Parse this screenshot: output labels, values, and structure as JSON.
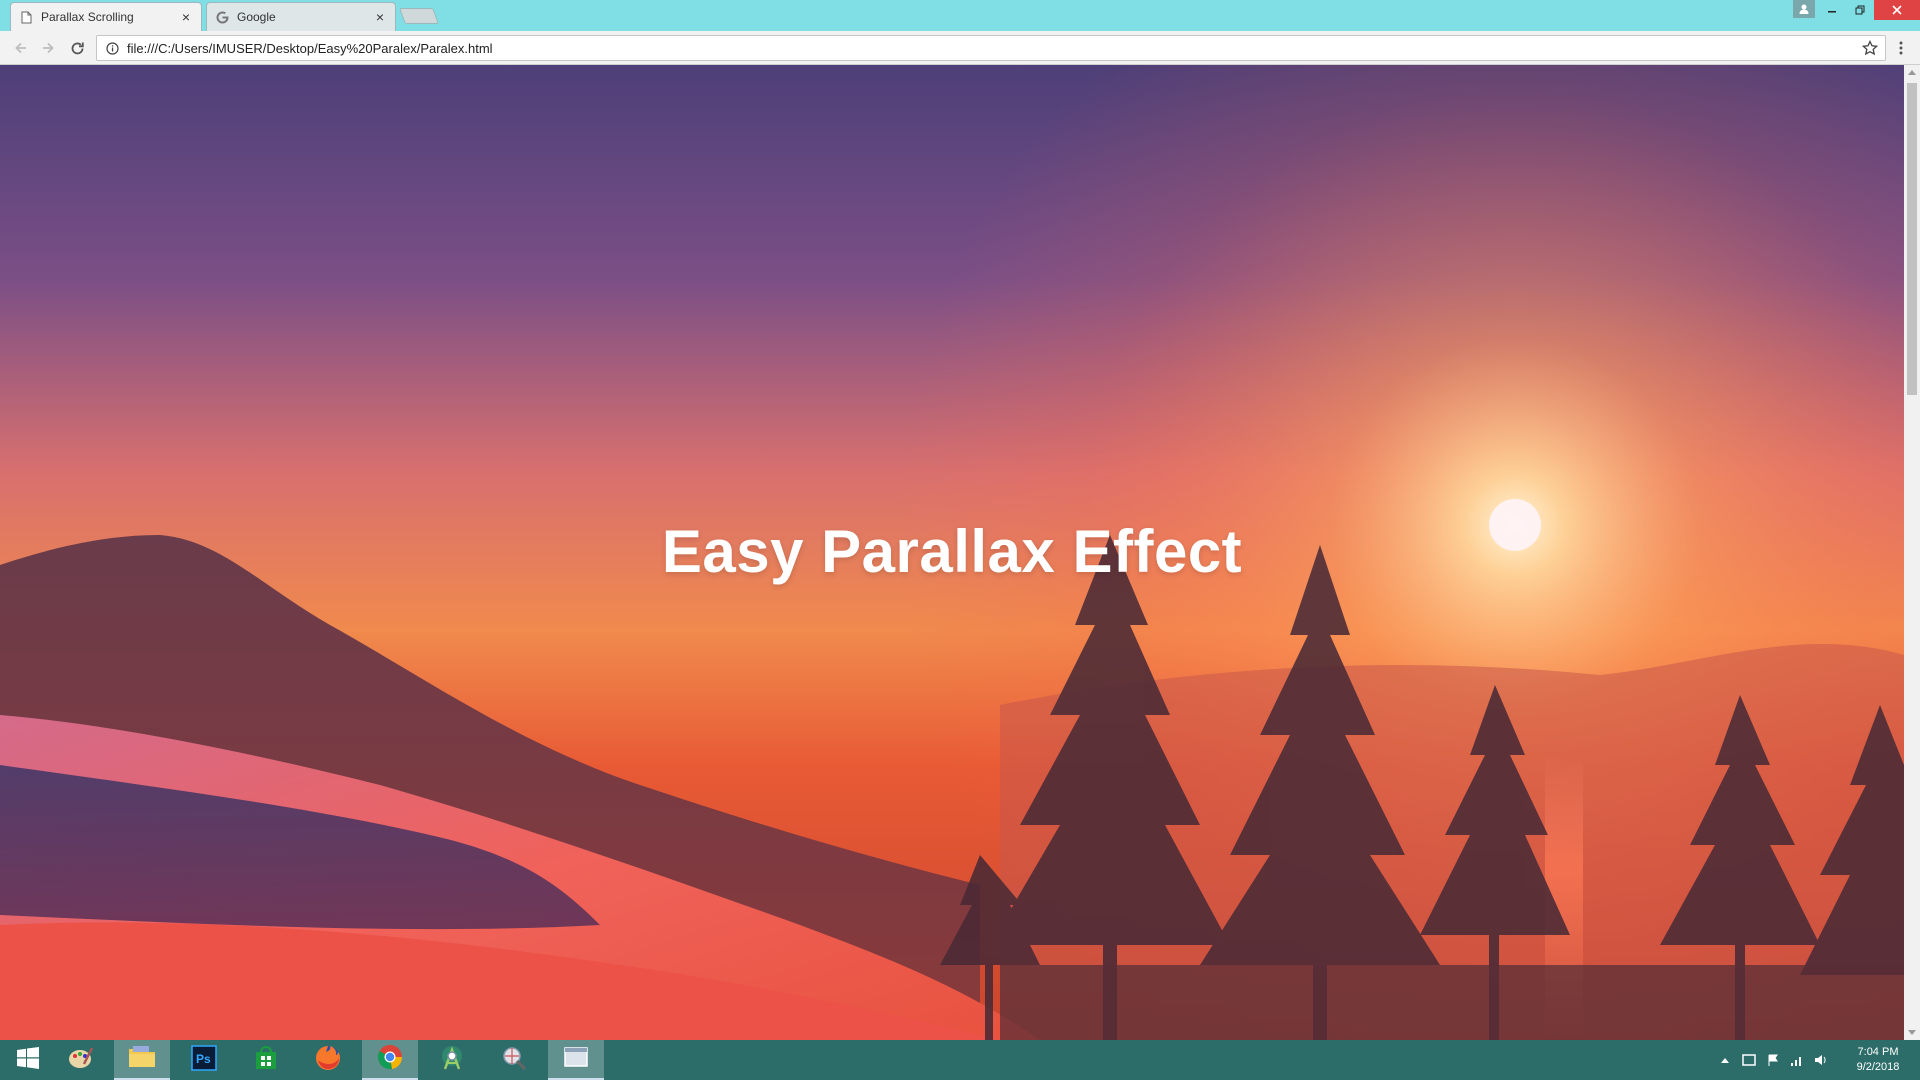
{
  "browser": {
    "tabs": [
      {
        "title": "Parallax Scrolling",
        "icon": "page-icon",
        "active": true
      },
      {
        "title": "Google",
        "icon": "google-icon",
        "active": false
      }
    ],
    "url": "file:///C:/Users/IMUSER/Desktop/Easy%20Paralex/Paralex.html"
  },
  "page": {
    "heading": "Easy Parallax Effect",
    "background": "sunset-mountain-forest-photo"
  },
  "taskbar": {
    "apps": [
      {
        "name": "start",
        "icon": "windows-logo-icon"
      },
      {
        "name": "paint",
        "icon": "paint-palette-icon"
      },
      {
        "name": "file-explorer",
        "icon": "folder-icon",
        "active": true
      },
      {
        "name": "photoshop",
        "icon": "photoshop-icon",
        "label": "Ps"
      },
      {
        "name": "store",
        "icon": "store-icon"
      },
      {
        "name": "firefox",
        "icon": "firefox-icon"
      },
      {
        "name": "chrome",
        "icon": "chrome-icon",
        "active": true
      },
      {
        "name": "android-studio",
        "icon": "android-studio-icon"
      },
      {
        "name": "app",
        "icon": "globe-tool-icon"
      },
      {
        "name": "screen-recorder",
        "icon": "window-icon",
        "active": true
      }
    ],
    "clock": {
      "time": "7:04 PM",
      "date": "9/2/2018"
    }
  },
  "colors": {
    "titlebar": "#80dfe5",
    "taskbar": "#2c6d69",
    "close": "#e04343",
    "sky_top": "#5a4a82",
    "sun": "#ffe7a8"
  }
}
